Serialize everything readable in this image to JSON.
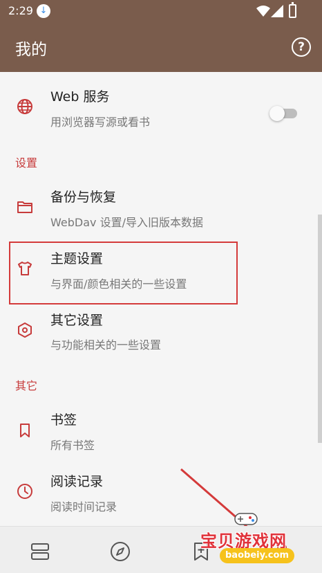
{
  "status_bar": {
    "time": "2:29",
    "download_icon": "download-icon"
  },
  "app_bar": {
    "title": "我的",
    "help": "?"
  },
  "items": {
    "web": {
      "title": "Web 服务",
      "subtitle": "用浏览器写源或看书",
      "icon": "globe-icon",
      "toggle": false
    },
    "backup": {
      "title": "备份与恢复",
      "subtitle": "WebDav 设置/导入旧版本数据",
      "icon": "folder-icon"
    },
    "theme": {
      "title": "主题设置",
      "subtitle": "与界面/颜色相关的一些设置",
      "icon": "shirt-icon"
    },
    "other_settings": {
      "title": "其它设置",
      "subtitle": "与功能相关的一些设置",
      "icon": "hexagon-icon"
    },
    "bookmark": {
      "title": "书签",
      "subtitle": "所有书签",
      "icon": "bookmark-icon"
    },
    "read_record": {
      "title": "阅读记录",
      "subtitle": "阅读时间记录",
      "icon": "clock-icon"
    }
  },
  "sections": {
    "settings": "设置",
    "others": "其它"
  },
  "bottom_nav": [
    "bookshelf-icon",
    "compass-icon",
    "rss-add-icon",
    "my-icon"
  ],
  "watermark": {
    "text": "宝贝游戏网",
    "url": "baobeiy.com"
  },
  "colors": {
    "app_bar": "#7a5c4c",
    "accent": "#c73b3b",
    "highlight": "#d43a3a"
  }
}
